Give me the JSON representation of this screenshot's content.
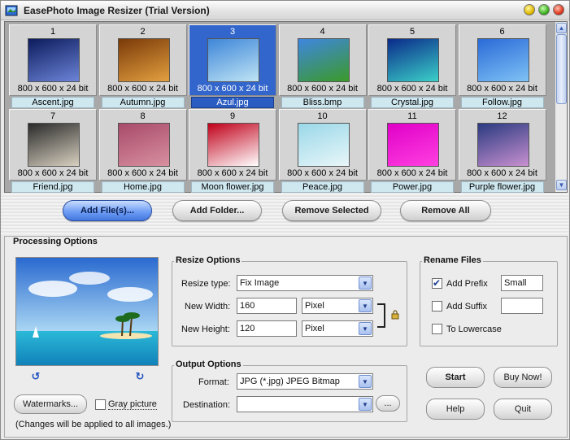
{
  "window": {
    "title": "EasePhoto Image Resizer (Trial Version)"
  },
  "thumbnails": [
    {
      "num": "1",
      "info": "800 x 600 x 24 bit",
      "name": "Ascent.jpg",
      "selected": false,
      "colors": [
        "#0c1b5c",
        "#6c84d8"
      ]
    },
    {
      "num": "2",
      "info": "800 x 600 x 24 bit",
      "name": "Autumn.jpg",
      "selected": false,
      "colors": [
        "#7a3a08",
        "#e3a040"
      ]
    },
    {
      "num": "3",
      "info": "800 x 600 x 24 bit",
      "name": "Azul.jpg",
      "selected": true,
      "colors": [
        "#3e86d8",
        "#bfe4f5"
      ]
    },
    {
      "num": "4",
      "info": "800 x 600 x 24 bit",
      "name": "Bliss.bmp",
      "selected": false,
      "colors": [
        "#3e86e0",
        "#3c9a28"
      ]
    },
    {
      "num": "5",
      "info": "800 x 600 x 24 bit",
      "name": "Crystal.jpg",
      "selected": false,
      "colors": [
        "#0a2a8a",
        "#3bd0c8"
      ]
    },
    {
      "num": "6",
      "info": "800 x 600 x 24 bit",
      "name": "Follow.jpg",
      "selected": false,
      "colors": [
        "#2a6ad8",
        "#7fc2f5"
      ]
    },
    {
      "num": "7",
      "info": "800 x 600 x 24 bit",
      "name": "Friend.jpg",
      "selected": false,
      "colors": [
        "#2a2a2a",
        "#d8d0c0"
      ]
    },
    {
      "num": "8",
      "info": "800 x 600 x 24 bit",
      "name": "Home.jpg",
      "selected": false,
      "colors": [
        "#a84a6a",
        "#d890a0"
      ]
    },
    {
      "num": "9",
      "info": "800 x 600 x 24 bit",
      "name": "Moon flower.jpg",
      "selected": false,
      "colors": [
        "#c0001a",
        "#ffffff"
      ]
    },
    {
      "num": "10",
      "info": "800 x 600 x 24 bit",
      "name": "Peace.jpg",
      "selected": false,
      "colors": [
        "#9ad8e8",
        "#e8f6f9"
      ]
    },
    {
      "num": "11",
      "info": "800 x 600 x 24 bit",
      "name": "Power.jpg",
      "selected": false,
      "colors": [
        "#e000c8",
        "#ff40e0"
      ]
    },
    {
      "num": "12",
      "info": "800 x 600 x 24 bit",
      "name": "Purple flower.jpg",
      "selected": false,
      "colors": [
        "#2a3a80",
        "#c890d0"
      ]
    }
  ],
  "actions": {
    "add_files": "Add File(s)...",
    "add_folder": "Add Folder...",
    "remove_selected": "Remove Selected",
    "remove_all": "Remove All"
  },
  "processing": {
    "title": "Processing Options",
    "watermarks": "Watermarks...",
    "gray_picture": "Gray picture",
    "note": "(Changes will be applied to all images.)"
  },
  "resize": {
    "title": "Resize Options",
    "type_label": "Resize type:",
    "type_value": "Fix Image",
    "width_label": "New Width:",
    "width_value": "160",
    "width_unit": "Pixel",
    "height_label": "New Height:",
    "height_value": "120",
    "height_unit": "Pixel"
  },
  "output": {
    "title": "Output Options",
    "format_label": "Format:",
    "format_value": "JPG (*.jpg) JPEG Bitmap",
    "destination_label": "Destination:",
    "destination_value": "",
    "browse": "..."
  },
  "rename": {
    "title": "Rename Files",
    "add_prefix": "Add Prefix",
    "prefix_value": "Small",
    "add_suffix": "Add Suffix",
    "suffix_value": "",
    "to_lowercase": "To Lowercase"
  },
  "buttons": {
    "start": "Start",
    "buy_now": "Buy Now!",
    "help": "Help",
    "quit": "Quit"
  }
}
